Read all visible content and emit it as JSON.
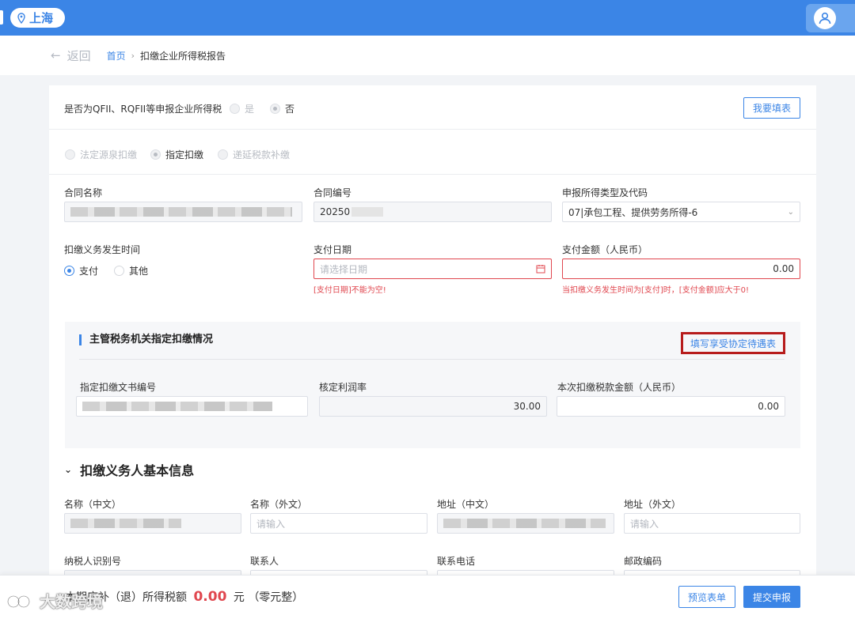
{
  "header": {
    "city": "上海",
    "icons": [
      "location-pin-icon",
      "user-avatar-icon"
    ]
  },
  "breadcrumb": {
    "back": "返回",
    "home": "首页",
    "current": "扣缴企业所得税报告"
  },
  "qfii": {
    "label": "是否为QFII、RQFII等申报企业所得税",
    "options": [
      "是",
      "否"
    ],
    "selected": "否",
    "fill_button": "我要填表"
  },
  "withholding_mode": {
    "options": [
      "法定源泉扣缴",
      "指定扣缴",
      "递延税款补缴"
    ],
    "selected": "指定扣缴"
  },
  "contract": {
    "name_label": "合同名称",
    "number_label": "合同编号",
    "number_value": "20250",
    "income_type_label": "申报所得类型及代码",
    "income_type_value": "07|承包工程、提供劳务所得-6"
  },
  "obligation": {
    "time_label": "扣缴义务发生时间",
    "time_options": [
      "支付",
      "其他"
    ],
    "time_selected": "支付",
    "pay_date_label": "支付日期",
    "pay_date_placeholder": "请选择日期",
    "pay_date_error": "[支付日期]不能为空!",
    "pay_amount_label": "支付金额（人民币）",
    "pay_amount_value": "0.00",
    "pay_amount_error": "当扣缴义务发生时间为[支付]时，[支付金额]应大于0!"
  },
  "designated": {
    "title": "主管税务机关指定扣缴情况",
    "link": "填写享受协定待遇表",
    "doc_no_label": "指定扣缴文书编号",
    "profit_rate_label": "核定利润率",
    "profit_rate_value": "30.00",
    "tax_amount_label": "本次扣缴税款金额（人民币）",
    "tax_amount_value": "0.00"
  },
  "agent": {
    "section_title": "扣缴义务人基本信息",
    "name_cn_label": "名称（中文）",
    "name_foreign_label": "名称（外文）",
    "name_foreign_placeholder": "请输入",
    "addr_cn_label": "地址（中文）",
    "addr_foreign_label": "地址（外文）",
    "addr_foreign_placeholder": "请输入",
    "tin_label": "纳税人识别号",
    "contact_label": "联系人",
    "phone_label": "联系电话",
    "postcode_label": "邮政编码"
  },
  "footer": {
    "tax_prefix": "本期应补（退）所得税额",
    "tax_amount": "0.00",
    "tax_unit": "元",
    "tax_words": "（零元整）",
    "preview_button": "预览表单",
    "submit_button": "提交申报"
  },
  "watermark": {
    "text": "大数跨境"
  },
  "colors": {
    "primary": "#3b85e6",
    "error": "#e0474f",
    "highlight_box": "#b71c1c"
  }
}
